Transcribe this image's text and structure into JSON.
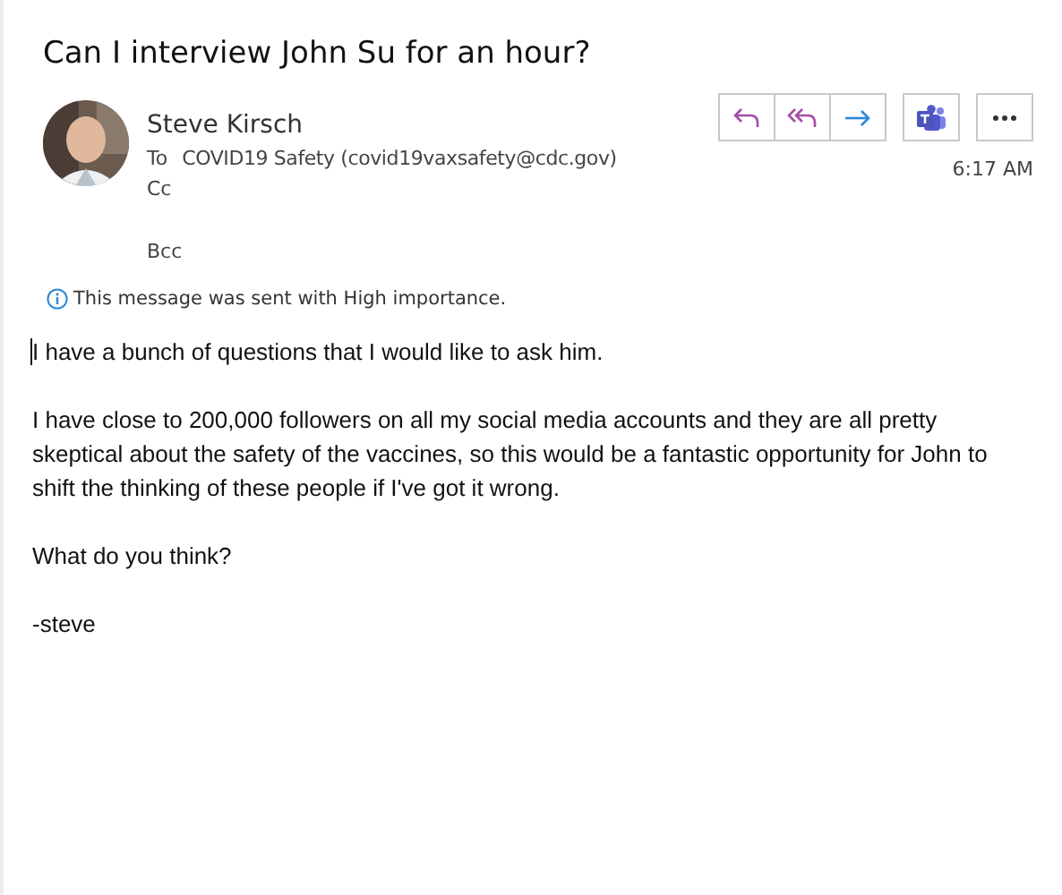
{
  "subject": "Can I interview John Su for an hour?",
  "sender": {
    "name": "Steve Kirsch"
  },
  "recipients": [
    {
      "label": "To",
      "value": "COVID19 Safety (covid19vaxsafety@cdc.gov)"
    },
    {
      "label": "Cc"
    }
  ],
  "bcc": {
    "label": "Bcc"
  },
  "time": "6:17 AM",
  "actions": [
    {
      "kind": "reply"
    },
    {
      "kind": "reply-all"
    },
    {
      "kind": "forward"
    },
    {
      "kind": "teams"
    },
    {
      "kind": "more"
    }
  ],
  "info_bar": "This message was sent with High importance.",
  "body": [
    "I have a bunch of questions that I would like to ask him.",
    "I have close to 200,000 followers on all my social media accounts and they are all pretty skeptical about the safety of the vaccines, so this would be a fantastic opportunity for John to shift the thinking of these people if I've got it wrong.",
    "What do you think?",
    "-steve"
  ]
}
